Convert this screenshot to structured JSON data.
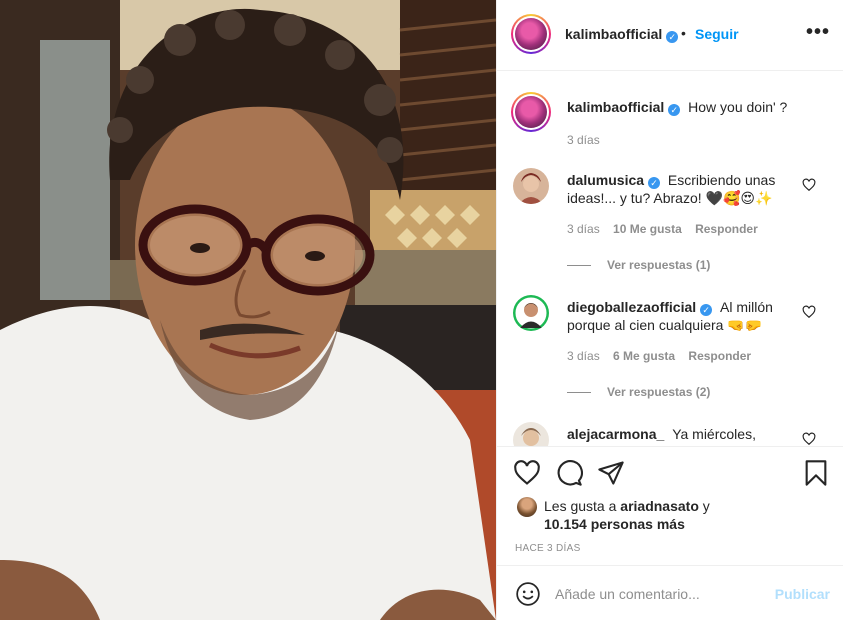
{
  "header": {
    "username": "kalimbaofficial",
    "separator": "•",
    "follow_label": "Seguir",
    "more_label": "•••"
  },
  "caption": {
    "username": "kalimbaofficial",
    "text": "How you doin' ?",
    "time": "3 días"
  },
  "comments": [
    {
      "username": "dalumusica",
      "text": "Escribiendo unas ideas!... y tu? Abrazo! 🖤🥰😍✨",
      "time": "3 días",
      "likes": "10 Me gusta",
      "reply_label": "Responder",
      "view_replies": "Ver respuestas (1)"
    },
    {
      "username": "diegoballezaofficial",
      "text": "Al millón porque al cien cualquiera 🤜🤛",
      "time": "3 días",
      "likes": "6 Me gusta",
      "reply_label": "Responder",
      "view_replies": "Ver respuestas (2)"
    },
    {
      "username": "alejacarmona_",
      "text": "Ya miércoles,"
    }
  ],
  "likes": {
    "prefix": "Les gusta a",
    "user": "ariadnasato",
    "connector": "y",
    "count": "10.154 personas más"
  },
  "post_time": "HACE 3 DÍAS",
  "composer": {
    "placeholder": "Añade un comentario...",
    "post_label": "Publicar"
  },
  "icons": {
    "verified": "verified-badge-icon",
    "heart": "heart-icon",
    "comment": "comment-icon",
    "share": "share-icon",
    "save": "bookmark-icon",
    "emoji": "emoji-icon",
    "more": "more-options-icon"
  },
  "colors": {
    "link_blue": "#0095f6",
    "verified_blue": "#3897f0",
    "publish_disabled": "#b2dffc",
    "muted_text": "#8e8e8e"
  }
}
